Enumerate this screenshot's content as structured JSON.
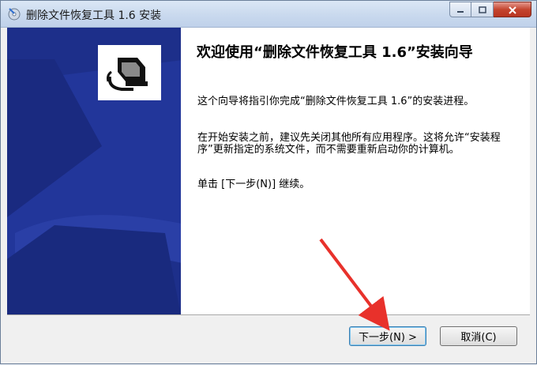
{
  "window": {
    "title": "删除文件恢复工具 1.6 安装"
  },
  "wizard": {
    "heading": "欢迎使用“删除文件恢复工具 1.6”安装向导",
    "paragraph1": "这个向导将指引你完成“删除文件恢复工具 1.6”的安装进程。",
    "paragraph2": "在开始安装之前，建议先关闭其他所有应用程序。这将允许“安装程序”更新指定的系统文件，而不需要重新启动你的计算机。",
    "paragraph3": "单击 [下一步(N)] 继续。"
  },
  "buttons": {
    "next_label": "下一步(N) >",
    "cancel_label": "取消(C)"
  },
  "colors": {
    "side_panel": "#1d2f8a",
    "annotation_arrow": "#e8312b"
  },
  "icons": {
    "app": "installer-disc-icon",
    "logo": "computer-install-icon",
    "minimize": "minimize-icon",
    "maximize": "maximize-icon",
    "close": "close-icon"
  }
}
